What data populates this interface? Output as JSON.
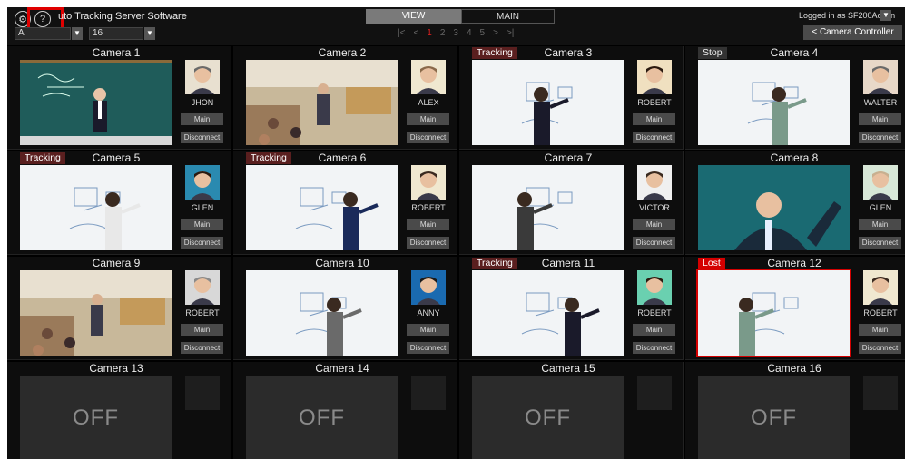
{
  "app": {
    "title": "uto Tracking Server Software",
    "settings_icon": "gear-icon",
    "help_icon": "help-icon",
    "help_glyph": "?",
    "settings_glyph": "⚙"
  },
  "toolbar": {
    "group_select": "A",
    "count_select": "16",
    "dropdown_glyph": "▼"
  },
  "mode_tabs": {
    "view": "VIEW",
    "main": "MAIN",
    "active": "VIEW"
  },
  "pager": {
    "first": "|<",
    "prev": "<",
    "pages": [
      "1",
      "2",
      "3",
      "4",
      "5"
    ],
    "current": "1",
    "next": ">",
    "last": ">|"
  },
  "user": {
    "login_text": "Logged in as SF200Admin"
  },
  "camera_controller_button": "< Camera Controller",
  "buttons": {
    "main": "Main",
    "disconnect": "Disconnect"
  },
  "off_label": "OFF",
  "cameras": [
    {
      "title": "Camera 1",
      "status": "",
      "person": "JHON",
      "scene": "chalkboard"
    },
    {
      "title": "Camera 2",
      "status": "",
      "person": "ALEX",
      "scene": "lecture"
    },
    {
      "title": "Camera 3",
      "status": "Tracking",
      "person": "ROBERT",
      "scene": "whiteboard"
    },
    {
      "title": "Camera 4",
      "status": "Stop",
      "person": "WALTER",
      "scene": "whiteboard"
    },
    {
      "title": "Camera 5",
      "status": "Tracking",
      "person": "GLEN",
      "scene": "whiteboard"
    },
    {
      "title": "Camera 6",
      "status": "Tracking",
      "person": "ROBERT",
      "scene": "whiteboard"
    },
    {
      "title": "Camera 7",
      "status": "",
      "person": "VICTOR",
      "scene": "whiteboard"
    },
    {
      "title": "Camera 8",
      "status": "",
      "person": "GLEN",
      "scene": "teal"
    },
    {
      "title": "Camera 9",
      "status": "",
      "person": "ROBERT",
      "scene": "lecture"
    },
    {
      "title": "Camera 10",
      "status": "",
      "person": "ANNY",
      "scene": "whiteboard"
    },
    {
      "title": "Camera 11",
      "status": "Tracking",
      "person": "ROBERT",
      "scene": "whiteboard"
    },
    {
      "title": "Camera 12",
      "status": "Lost",
      "person": "ROBERT",
      "scene": "whiteboard"
    },
    {
      "title": "Camera 13",
      "status": "",
      "person": "",
      "scene": "off"
    },
    {
      "title": "Camera 14",
      "status": "",
      "person": "",
      "scene": "off"
    },
    {
      "title": "Camera 15",
      "status": "",
      "person": "",
      "scene": "off"
    },
    {
      "title": "Camera 16",
      "status": "",
      "person": "",
      "scene": "off"
    }
  ],
  "colors": {
    "tracking": "#5a1f1f",
    "lost": "#d40000",
    "highlight": "#e00000",
    "page_active": "#e02020"
  }
}
